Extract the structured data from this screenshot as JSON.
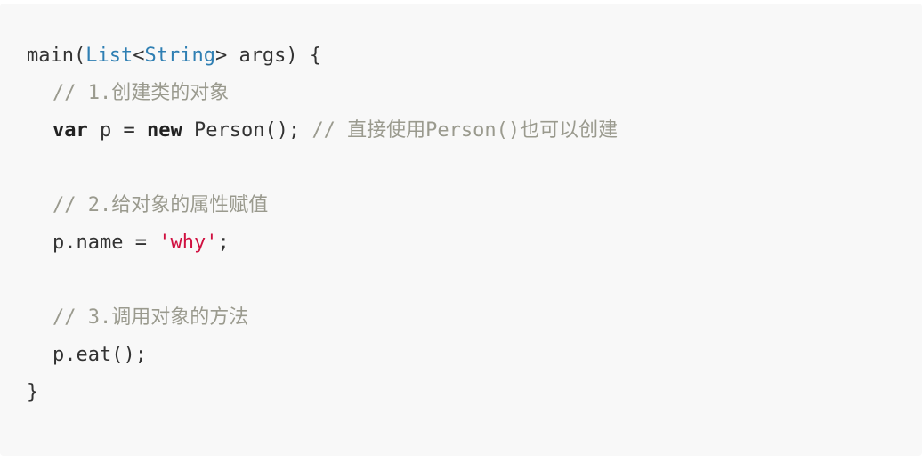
{
  "code": {
    "l1": {
      "fn": "main(",
      "t1": "List",
      "lt": "<",
      "t2": "String",
      "rest": "> args) {"
    },
    "l2": {
      "comment": "// 1.创建类的对象"
    },
    "l3": {
      "kw1": "var",
      "mid1": " p = ",
      "kw2": "new",
      "mid2": " Person(); ",
      "comment": "// 直接使用Person()也可以创建"
    },
    "l4": {
      "comment": "// 2.给对象的属性赋值"
    },
    "l5": {
      "pre": "p.name = ",
      "str": "'why'",
      "post": ";"
    },
    "l6": {
      "comment": "// 3.调用对象的方法"
    },
    "l7": {
      "text": "p.eat();"
    },
    "l8": {
      "text": "}"
    }
  }
}
